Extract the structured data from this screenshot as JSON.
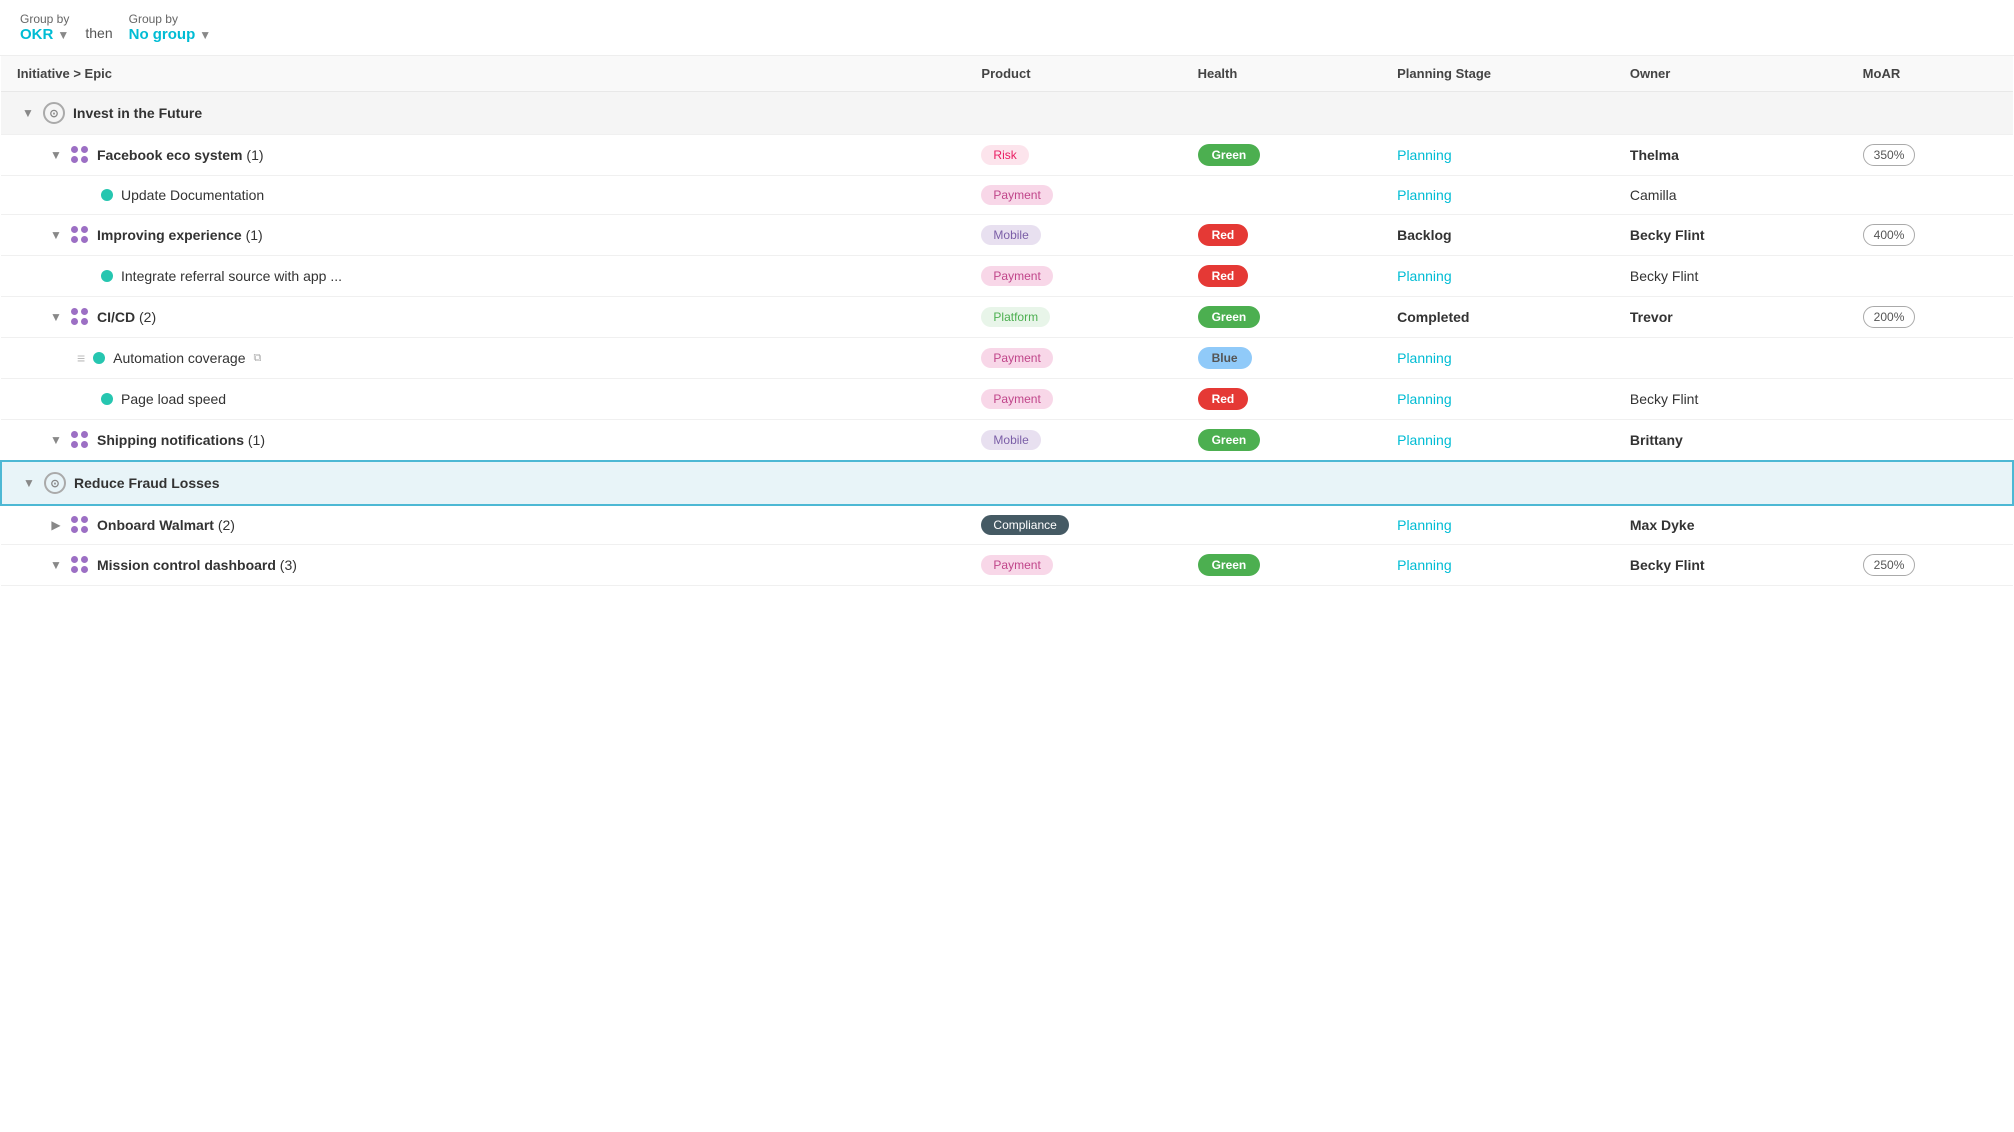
{
  "toolbar": {
    "group_by_1_label": "Group by",
    "group_by_1_value": "OKR",
    "then_label": "then",
    "group_by_2_label": "Group by",
    "group_by_2_value": "No group"
  },
  "table": {
    "headers": {
      "col1": "Initiative > Epic",
      "col2": "Product",
      "col3": "Health",
      "col4": "Planning Stage",
      "col5": "Owner",
      "col6": "MoAR"
    },
    "groups": [
      {
        "id": "g1",
        "name": "Invest in the Future",
        "selected": false,
        "epics": [
          {
            "name": "Facebook eco system",
            "count": 1,
            "product": "Risk",
            "product_class": "badge-risk",
            "health": "Green",
            "health_class": "health-green",
            "planning": "Planning",
            "planning_type": "link",
            "owner": "Thelma",
            "owner_bold": true,
            "moar": "350%",
            "items": [
              {
                "name": "Update Documentation",
                "product": "Payment",
                "product_class": "badge-payment",
                "health": "",
                "health_class": "",
                "planning": "Planning",
                "planning_type": "link",
                "owner": "Camilla",
                "owner_bold": false,
                "moar": ""
              }
            ]
          },
          {
            "name": "Improving experience",
            "count": 1,
            "product": "Mobile",
            "product_class": "badge-mobile",
            "health": "Red",
            "health_class": "health-red",
            "planning": "Backlog",
            "planning_type": "text",
            "owner": "Becky Flint",
            "owner_bold": true,
            "moar": "400%",
            "items": [
              {
                "name": "Integrate referral source with app ...",
                "product": "Payment",
                "product_class": "badge-payment",
                "health": "Red",
                "health_class": "health-red",
                "planning": "Planning",
                "planning_type": "link",
                "owner": "Becky Flint",
                "owner_bold": false,
                "moar": ""
              }
            ]
          },
          {
            "name": "CI/CD",
            "count": 2,
            "product": "Platform",
            "product_class": "badge-platform",
            "health": "Green",
            "health_class": "health-green",
            "planning": "Completed",
            "planning_type": "text",
            "owner": "Trevor",
            "owner_bold": true,
            "moar": "200%",
            "items": [
              {
                "name": "Automation coverage",
                "product": "Payment",
                "product_class": "badge-payment",
                "health": "Blue",
                "health_class": "health-blue",
                "planning": "Planning",
                "planning_type": "link",
                "owner": "",
                "owner_bold": false,
                "moar": "",
                "has_drag": true,
                "has_external": true
              },
              {
                "name": "Page load speed",
                "product": "Payment",
                "product_class": "badge-payment",
                "health": "Red",
                "health_class": "health-red",
                "planning": "Planning",
                "planning_type": "link",
                "owner": "Becky Flint",
                "owner_bold": false,
                "moar": ""
              }
            ]
          },
          {
            "name": "Shipping notifications",
            "count": 1,
            "product": "Mobile",
            "product_class": "badge-mobile",
            "health": "Green",
            "health_class": "health-green",
            "planning": "Planning",
            "planning_type": "link",
            "owner": "Brittany",
            "owner_bold": true,
            "moar": "",
            "items": []
          }
        ]
      },
      {
        "id": "g2",
        "name": "Reduce Fraud Losses",
        "selected": true,
        "epics": [
          {
            "name": "Onboard Walmart",
            "count": 2,
            "product": "Compliance",
            "product_class": "badge-compliance",
            "health": "",
            "health_class": "",
            "planning": "Planning",
            "planning_type": "link",
            "owner": "Max Dyke",
            "owner_bold": true,
            "moar": "",
            "collapsed": true,
            "items": []
          },
          {
            "name": "Mission control dashboard",
            "count": 3,
            "product": "Payment",
            "product_class": "badge-payment",
            "health": "Green",
            "health_class": "health-green",
            "planning": "Planning",
            "planning_type": "link",
            "owner": "Becky Flint",
            "owner_bold": true,
            "moar": "250%",
            "items": []
          }
        ]
      }
    ]
  }
}
